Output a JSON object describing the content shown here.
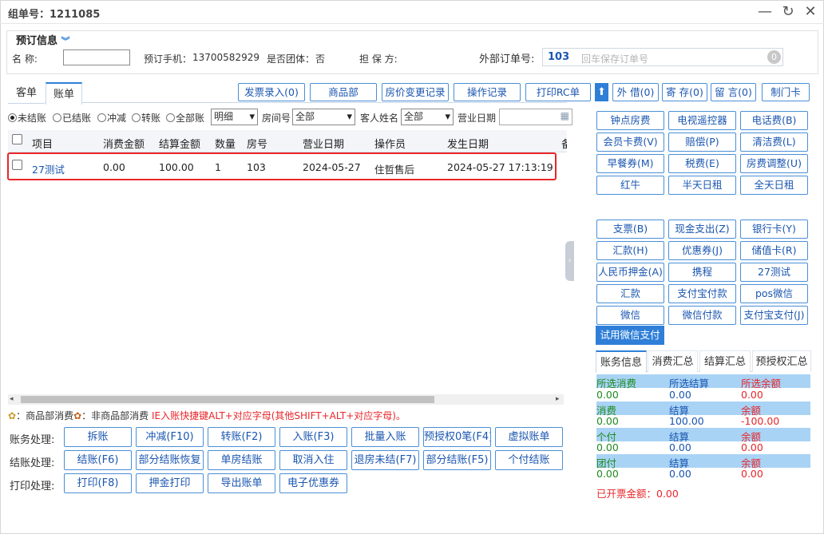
{
  "window": {
    "title": "组单号：1211085",
    "min_icon": "minimize-icon",
    "restore_icon": "restore-icon",
    "close_icon": "close-icon"
  },
  "booking": {
    "legend": "预订信息",
    "name_label": "名    称:",
    "name_value": "",
    "phone_label": "预订手机：",
    "phone_value": "13700582929",
    "group_label": "是否团体：",
    "group_value": "否",
    "guarantee_label": "担 保 方:",
    "ext_order_label": "外部订单号:",
    "ext_order_value": "103",
    "ext_order_placeholder": "回车保存订单号",
    "ext_badge": "0"
  },
  "tabs": [
    "客单",
    "账单"
  ],
  "actions": [
    "发票录入(0)",
    "商品部",
    "房价变更记录",
    "操作记录",
    "打印RC单",
    "外 借(0)",
    "寄 存(0)",
    "留 言(0)",
    "制门卡"
  ],
  "filters": {
    "radios": [
      "未结账",
      "已结账",
      "冲减",
      "转账",
      "全部账"
    ],
    "detail_value": "明细",
    "room_label": "房间号",
    "room_value": "全部",
    "guest_label": "客人姓名",
    "guest_value": "全部",
    "date_label": "营业日期"
  },
  "table": {
    "headers": [
      "项目",
      "消费金额",
      "结算金额",
      "数量",
      "房号",
      "营业日期",
      "操作员",
      "发生日期",
      "备"
    ],
    "rows": [
      {
        "item": "27测试",
        "consume": "0.00",
        "settle": "100.00",
        "qty": "1",
        "room": "103",
        "biz_date": "2024-05-27",
        "operator": "住哲售后",
        "time": "2024-05-27 17:13:19"
      }
    ]
  },
  "legend_note": {
    "a": "：商品部消费",
    "b": "：非商品部消费",
    "hint": "IE入账快捷键ALT+对应字母(其他SHIFT+ALT+对应字母)。"
  },
  "bottom": {
    "row1_label": "账务处理:",
    "row1": [
      "拆账",
      "冲减(F10)",
      "转账(F2)",
      "入账(F3)",
      "批量入账",
      "预授权0笔(F4)",
      "虚拟账单"
    ],
    "row2_label": "结账处理:",
    "row2": [
      "结账(F6)",
      "部分结账恢复",
      "单房结账",
      "取消入住",
      "退房未结(F7)",
      "部分结账(F5)",
      "个付结账"
    ],
    "row3_label": "打印处理:",
    "row3": [
      "打印(F8)",
      "押金打印",
      "导出账单",
      "电子优惠券"
    ]
  },
  "charges": [
    "钟点房费",
    "电视遥控器",
    "电话费(B)",
    "会员卡费(V)",
    "赔偿(P)",
    "清洁费(L)",
    "早餐券(M)",
    "税费(E)",
    "房费调整(U)",
    "红牛",
    "半天日租",
    "全天日租"
  ],
  "payments": [
    "支票(B)",
    "现金支出(Z)",
    "银行卡(Y)",
    "汇款(H)",
    "优惠券(J)",
    "储值卡(R)",
    "人民币押金(A)",
    "携程",
    "27测试",
    "汇款",
    "支付宝付款",
    "pos微信",
    "微信",
    "微信付款",
    "支付宝支付(J)"
  ],
  "wechat_pay": "试用微信支付",
  "summary_tabs": [
    "账务信息",
    "消费汇总",
    "结算汇总",
    "预授权汇总"
  ],
  "account": {
    "h1": [
      "所选消费",
      "所选结算",
      "所选余额"
    ],
    "v1": [
      "0.00",
      "0.00",
      "0.00"
    ],
    "h2": [
      "消费",
      "结算",
      "余额"
    ],
    "v2": [
      "0.00",
      "100.00",
      "-100.00"
    ],
    "h3": [
      "个付",
      "结算",
      "余额"
    ],
    "v3": [
      "0.00",
      "0.00",
      "0.00"
    ],
    "h4": [
      "团付",
      "结算",
      "余额"
    ],
    "v4": [
      "0.00",
      "0.00",
      "0.00"
    ],
    "invoice": "已开票金额：0.00"
  },
  "colors": {
    "accent": "#1a56b0",
    "highlight": "#e8262a",
    "header_blue": "#a9d3f5"
  }
}
